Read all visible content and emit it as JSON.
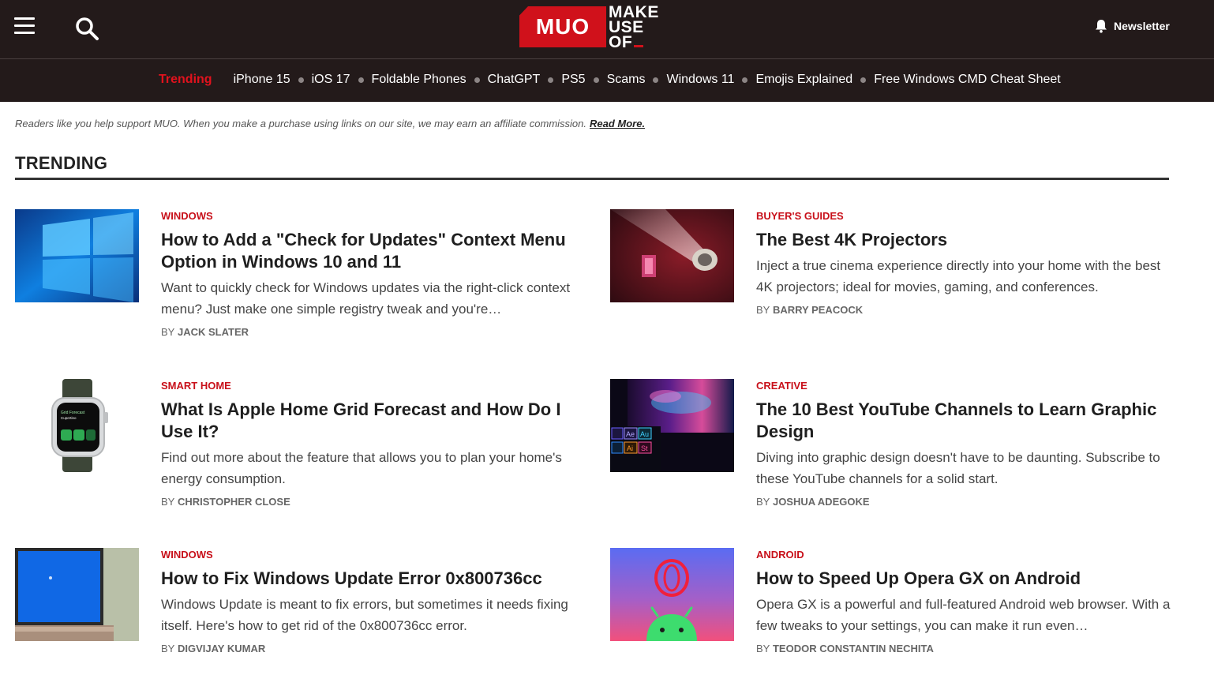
{
  "header": {
    "logo_short": "MUO",
    "logo_lines": [
      "MAKE",
      "USE",
      "OF"
    ],
    "newsletter_label": "Newsletter"
  },
  "trending_bar": {
    "label": "Trending",
    "links": [
      "iPhone 15",
      "iOS 17",
      "Foldable Phones",
      "ChatGPT",
      "PS5",
      "Scams",
      "Windows 11",
      "Emojis Explained",
      "Free Windows CMD Cheat Sheet"
    ]
  },
  "disclaimer": {
    "text": "Readers like you help support MUO. When you make a purchase using links on our site, we may earn an affiliate commission.",
    "link": "Read More."
  },
  "section": {
    "title": "TRENDING"
  },
  "articles": [
    {
      "category": "WINDOWS",
      "title": "How to Add a \"Check for Updates\" Context Menu Option in Windows 10 and 11",
      "excerpt": "Want to quickly check for Windows updates via the right-click context menu? Just make one simple registry tweak and you're…",
      "by": "BY",
      "author": "JACK SLATER"
    },
    {
      "category": "BUYER'S GUIDES",
      "title": "The Best 4K Projectors",
      "excerpt": "Inject a true cinema experience directly into your home with the best 4K projectors; ideal for movies, gaming, and conferences.",
      "by": "BY",
      "author": "BARRY PEACOCK"
    },
    {
      "category": "SMART HOME",
      "title": "What Is Apple Home Grid Forecast and How Do I Use It?",
      "excerpt": "Find out more about the feature that allows you to plan your home's energy consumption.",
      "by": "BY",
      "author": "CHRISTOPHER CLOSE"
    },
    {
      "category": "CREATIVE",
      "title": "The 10 Best YouTube Channels to Learn Graphic Design",
      "excerpt": "Diving into graphic design doesn't have to be daunting. Subscribe to these YouTube channels for a solid start.",
      "by": "BY",
      "author": "JOSHUA ADEGOKE"
    },
    {
      "category": "WINDOWS",
      "title": "How to Fix Windows Update Error 0x800736cc",
      "excerpt": "Windows Update is meant to fix errors, but sometimes it needs fixing itself. Here's how to get rid of the 0x800736cc error.",
      "by": "BY",
      "author": "DIGVIJAY KUMAR"
    },
    {
      "category": "ANDROID",
      "title": "How to Speed Up Opera GX on Android",
      "excerpt": "Opera GX is a powerful and full-featured Android web browser. With a few tweaks to your settings, you can make it run even…",
      "by": "BY",
      "author": "TEODOR CONSTANTIN NECHITA"
    }
  ],
  "thumbnail_art": {
    "watch_screen_text": [
      "Grid Forecast",
      "Cupertino"
    ],
    "app_tiles": [
      "Ae",
      "Au",
      "Ai",
      "St"
    ]
  },
  "colors": {
    "header_bg": "#231a1a",
    "accent_red": "#d0111b",
    "category_red": "#c8101a"
  }
}
